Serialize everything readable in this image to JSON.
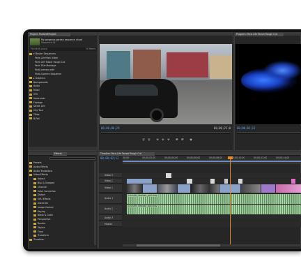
{
  "project": {
    "tab": "Project: ParisEditProject",
    "thumb_caption_1": "My gorgeous garden sequence shoot",
    "thumb_caption_2": "Sequence 01",
    "count": "10 Items",
    "search_placeholder": "ParisEdit.prproj",
    "items": [
      "▾ Master Sequences",
      "Paris Life Main Video",
      "Paris Life Teaser Rough Cut",
      "Paris Title Montage",
      "Multi-camera edit",
      "Multi-Camera Sequence",
      "▸ Graphics",
      "Backgrounds",
      "Audio",
      "Music",
      "SFX",
      "Voice-over",
      "Footage",
      "Street Life",
      "City Tour",
      "Titles",
      "B-Roll"
    ]
  },
  "effects": {
    "tab": "Effects",
    "items": [
      "Presets",
      "Audio Effects",
      "Audio Transitions",
      "Video Effects",
      "Adjust",
      "Blur & Sharpen",
      "Channel",
      "Color Correction",
      "Distort",
      "GPU Effects",
      "Generate",
      "Image Control",
      "Keying",
      "Noise & Grain",
      "Perspective",
      "Render",
      "Stylize",
      "Time",
      "Transform",
      "Transition"
    ]
  },
  "source": {
    "timecode_in": "00;00;00;29",
    "timecode_out": "00;00;22;0"
  },
  "program": {
    "tab": "Program: Paris Life Teaser Rough Cut",
    "timecode_in": "00;00;02;12"
  },
  "timeline": {
    "tab": "Timeline: Paris Life Teaser Rough Cut",
    "timecode": "00;00;02;12",
    "ruler_labels": [
      "00;00",
      "00;00;02;00",
      "00;00;04;00",
      "00;00;06;00",
      "00;00;08;00",
      "00;00;10;00",
      "00;00;12;00",
      "00;00;14;00"
    ],
    "video_tracks": [
      "Video 3",
      "Video 2",
      "Video 1"
    ],
    "audio_tracks": [
      "Audio 1",
      "Audio 2",
      "Audio 3",
      "Master"
    ],
    "audio_clip_1": "Leicuffe_lltraaaa_ppll.mbv",
    "audio_clip_2": "Leicuffe_lltraaaa_ppll.mbv"
  },
  "colors": {
    "accent_blue": "#5aa7ff",
    "playhead": "#e08a2a",
    "clip_video": "#8aa2c8",
    "clip_audio": "#8fbf8a",
    "folder": "#c9a43c"
  }
}
